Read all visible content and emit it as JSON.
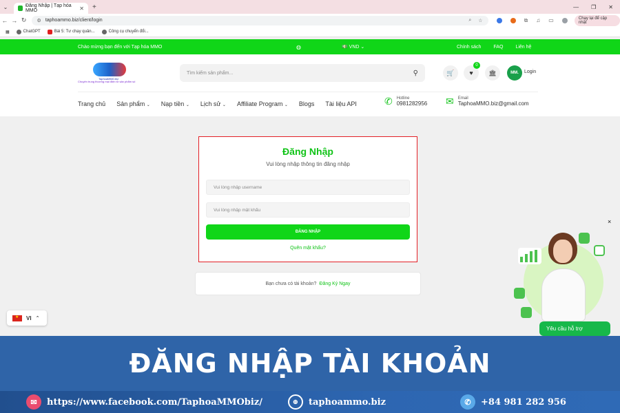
{
  "browser": {
    "tab_title": "Đăng Nhập | Tạp hóa MMO",
    "url": "taphoammo.biz/client/login",
    "update_label": "Chạy lại để cập nhật",
    "bookmarks": [
      "ChatGPT",
      "Bài 5: Tư chạy quản...",
      "Công cụ chuyển đổi..."
    ]
  },
  "topbar": {
    "welcome": "Chào mừng bạn đến với Tạp hóa MMO",
    "currency": "VND",
    "links": [
      "Chính sách",
      "FAQ",
      "Liên hệ"
    ]
  },
  "header": {
    "logo_brand": "TaphoaMMO.biz",
    "logo_slogan": "Chuyên trung thương mại điện tử sản phẩm số",
    "search_placeholder": "Tìm kiếm sản phẩm...",
    "wishlist_count": "0",
    "avatar": "MM.",
    "login": "Login",
    "nav": [
      "Trang chủ",
      "Sản phẩm",
      "Nạp tiền",
      "Lịch sử",
      "Affiliate Program",
      "Blogs",
      "Tài liệu API"
    ],
    "hotline_label": "Hotline",
    "hotline_value": "0981282956",
    "email_label": "Email",
    "email_value": "TaphoaMMO.biz@gmail.com"
  },
  "login_form": {
    "title": "Đăng Nhập",
    "subtitle": "Vui lòng nhập thông tin đăng nhập",
    "username_placeholder": "Vui lòng nhập username",
    "password_placeholder": "Vui lòng nhập mật khẩu",
    "submit": "ĐĂNG NHẬP",
    "forgot": "Quên mật khẩu?"
  },
  "register": {
    "prompt": "Bạn chưa có tài khoản?",
    "link": "Đăng Ký Ngay"
  },
  "support": {
    "button": "Yêu cầu hỗ trợ",
    "close": "×"
  },
  "language": {
    "code": "VI"
  },
  "banner": {
    "title": "ĐĂNG NHẬP TÀI KHOẢN"
  },
  "footer": {
    "facebook": "https://www.facebook.com/TaphoaMMObiz/",
    "website": "taphoammo.biz",
    "phone": "+84 981 282 956"
  },
  "colors": {
    "brand_green": "#10d618",
    "card_border": "#e31e24",
    "banner_blue": "#2f64a8"
  }
}
